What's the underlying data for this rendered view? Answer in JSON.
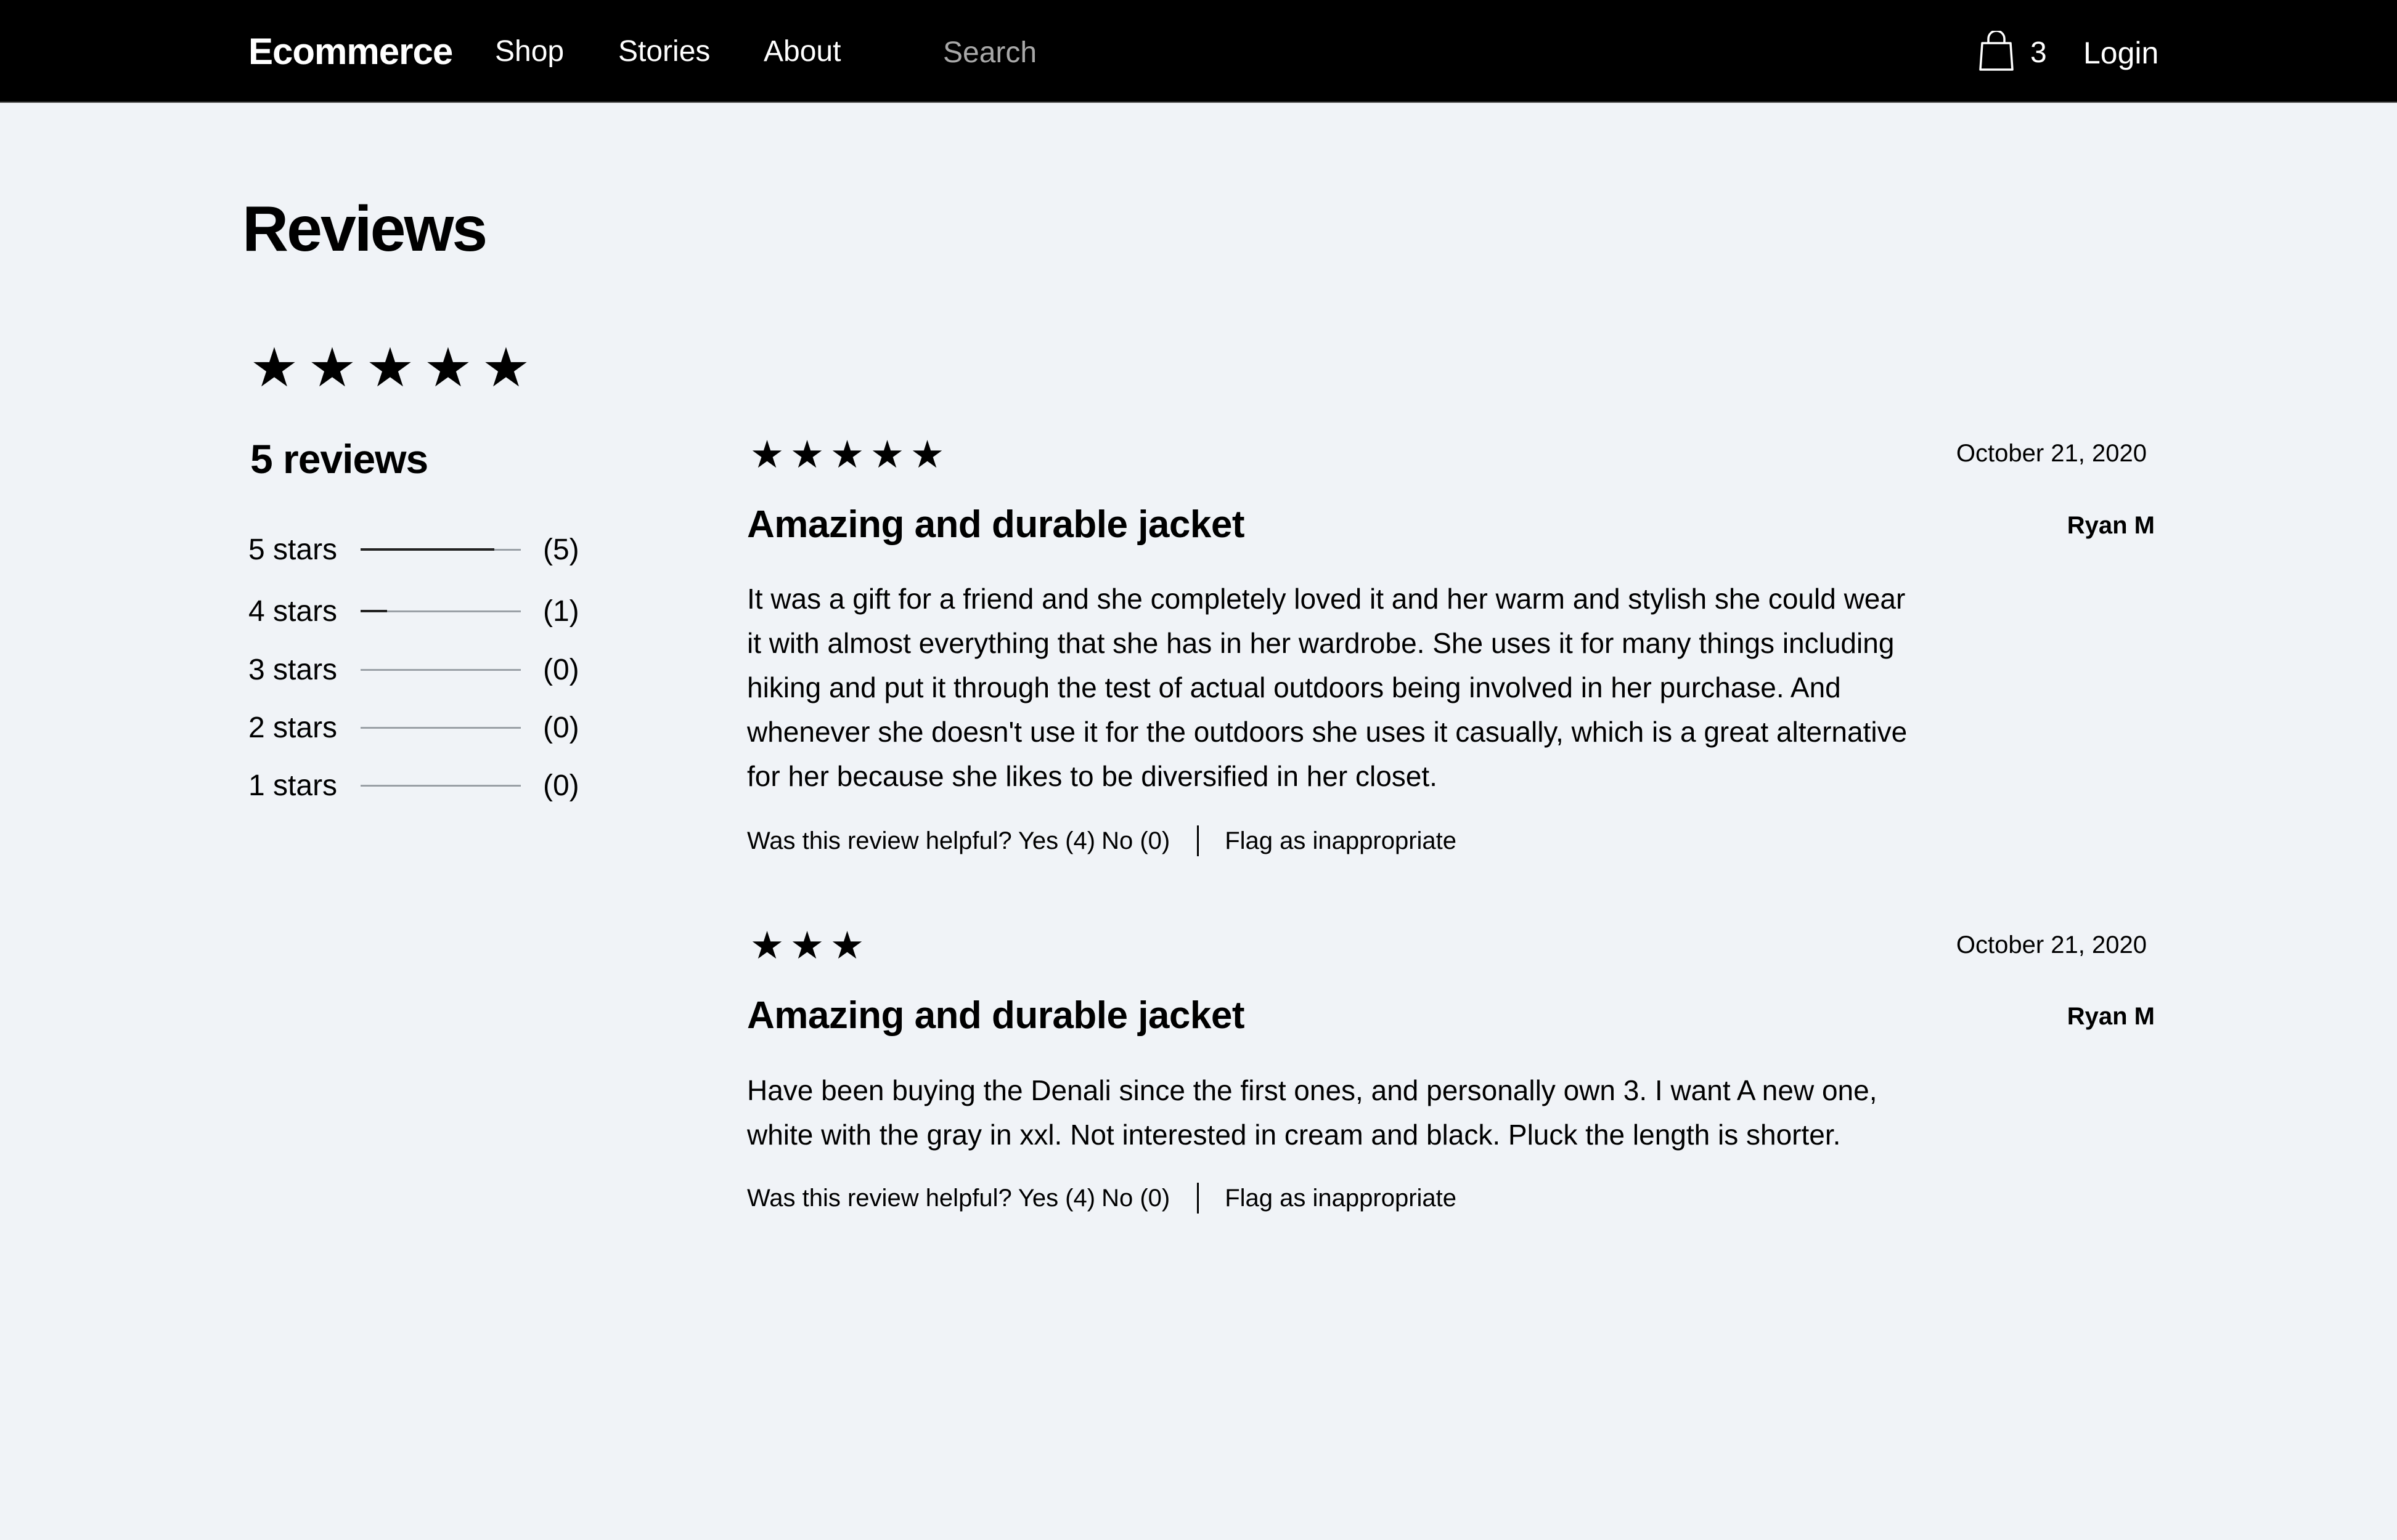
{
  "nav": {
    "brand": "Ecommerce",
    "links": [
      "Shop",
      "Stories",
      "About"
    ],
    "search_placeholder": "Search",
    "cart_count": "3",
    "login_label": "Login"
  },
  "page": {
    "title": "Reviews"
  },
  "summary": {
    "rating": 5,
    "total_label": "5 reviews",
    "breakdown": [
      {
        "label": "5 stars",
        "count_label": "(5)",
        "count": 5
      },
      {
        "label": "4 stars",
        "count_label": "(1)",
        "count": 1
      },
      {
        "label": "3 stars",
        "count_label": "(0)",
        "count": 0
      },
      {
        "label": "2 stars",
        "count_label": "(0)",
        "count": 0
      },
      {
        "label": "1 stars",
        "count_label": "(0)",
        "count": 0
      }
    ]
  },
  "reviews": [
    {
      "rating": 5,
      "date": "October 21, 2020",
      "title": "Amazing and durable jacket",
      "author": "Ryan M",
      "body": "It was a gift for a friend and she completely loved it and her warm and stylish she could wear it with almost everything that she has in her wardrobe. She uses it for many things including hiking and put it through the test of actual outdoors being involved in her purchase. And whenever she doesn't use it for the outdoors she uses it casually, which is a great alternative for her because she likes to be diversified in her closet.",
      "helpful_question": "Was this review helpful?",
      "helpful_yes": "Yes (4)",
      "helpful_no": "No (0)",
      "flag_label": "Flag as inappropriate"
    },
    {
      "rating": 3,
      "date": "October 21, 2020",
      "title": "Amazing and durable jacket",
      "author": "Ryan M",
      "body": "Have been buying the Denali since the first ones, and personally own 3. I want A new one, white with the gray in xxl. Not interested in cream and black. Pluck the length is shorter.",
      "helpful_question": "Was this review helpful?",
      "helpful_yes": "Yes (4)",
      "helpful_no": "No (0)",
      "flag_label": "Flag as inappropriate"
    }
  ],
  "icons": {
    "star": "★",
    "cart": "shopping-bag-icon"
  },
  "colors": {
    "nav_bg": "#000000",
    "page_bg": "#f0f3f7",
    "text": "#000000",
    "placeholder": "#a8a8a8"
  }
}
